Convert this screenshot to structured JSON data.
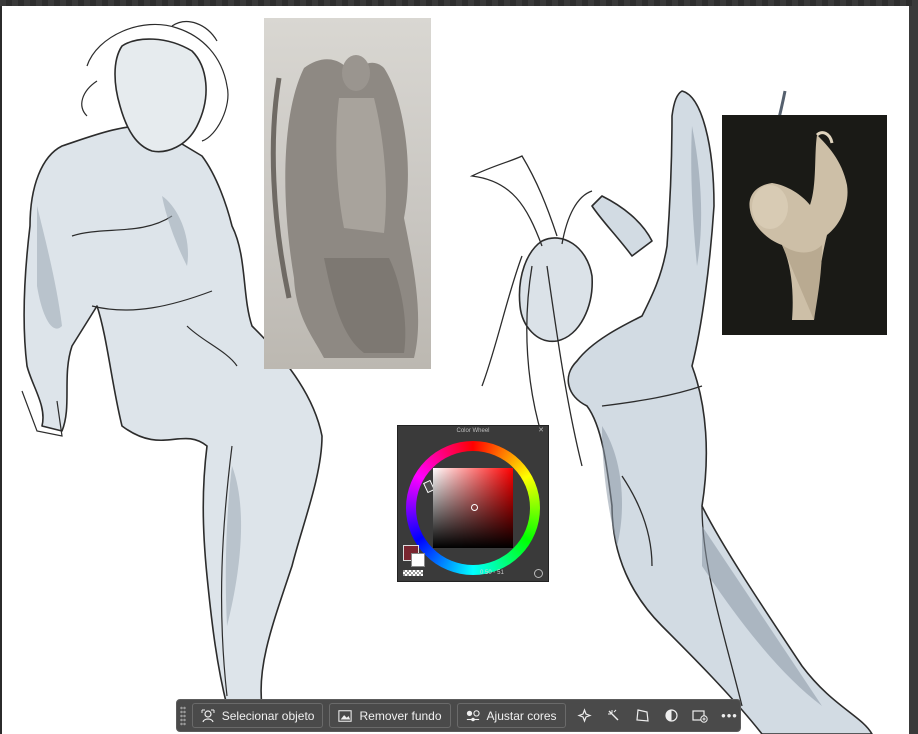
{
  "toolbar": {
    "buttons": [
      {
        "label": "Selecionar objeto",
        "icon": "select-subject-icon"
      },
      {
        "label": "Remover fundo",
        "icon": "remove-background-icon"
      },
      {
        "label": "Ajustar cores",
        "icon": "adjust-colors-icon"
      }
    ],
    "icon_buttons": [
      "generative-fill-icon",
      "selection-brush-icon",
      "transform-icon",
      "mask-icon",
      "add-layer-icon",
      "more-icon"
    ]
  },
  "color_wheel": {
    "title": "Color Wheel",
    "foreground_color": "#7a2630",
    "background_color": "#ffffff",
    "values": "0  50 ◦ 51"
  },
  "colors": {
    "canvas": "#ffffff",
    "app_bg": "#2b2b2b",
    "toolbar_bg": "#4a4a4a",
    "sketch_stroke": "#2c2c2c",
    "skin_shade": "#b9c6cf"
  }
}
